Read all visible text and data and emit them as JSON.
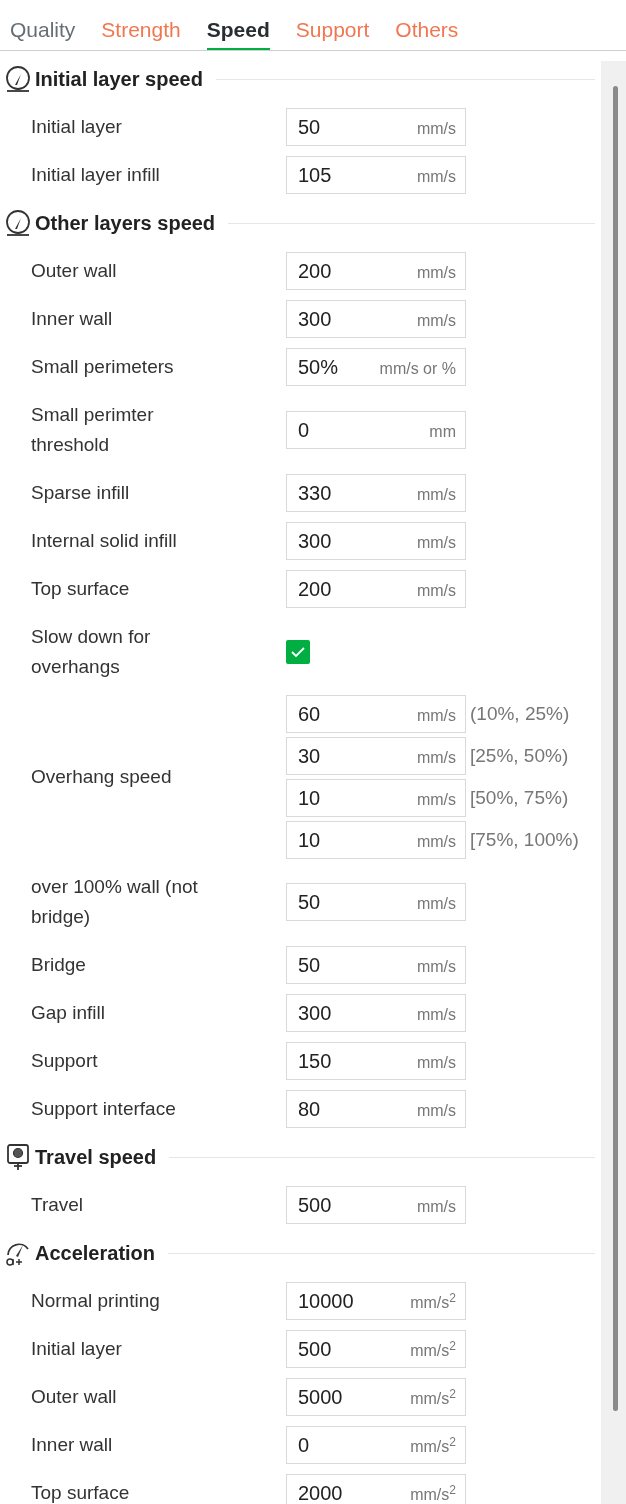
{
  "tabs": [
    {
      "label": "Quality",
      "selected": false,
      "modified": false
    },
    {
      "label": "Strength",
      "selected": false,
      "modified": true
    },
    {
      "label": "Speed",
      "selected": true
    },
    {
      "label": "Support",
      "selected": false,
      "modified": true
    },
    {
      "label": "Others",
      "selected": false,
      "modified": true
    }
  ],
  "sections": [
    {
      "title": "Initial layer speed",
      "kind": "gauge",
      "rows": [
        {
          "kind": "field",
          "label": "Initial layer",
          "value": "50",
          "unit": "mm/s"
        },
        {
          "kind": "field",
          "label": "Initial layer infill",
          "value": "105",
          "unit": "mm/s"
        }
      ]
    },
    {
      "title": "Other layers speed",
      "kind": "gauge",
      "rows": [
        {
          "kind": "field",
          "label": "Outer wall",
          "value": "200",
          "unit": "mm/s"
        },
        {
          "kind": "field",
          "label": "Inner wall",
          "value": "300",
          "unit": "mm/s"
        },
        {
          "kind": "field",
          "label": "Small perimeters",
          "value": "50%",
          "unit": "mm/s or %"
        },
        {
          "kind": "field",
          "label": "Small perimter threshold",
          "value": "0",
          "unit": "mm"
        },
        {
          "kind": "field",
          "label": "Sparse infill",
          "value": "330",
          "unit": "mm/s"
        },
        {
          "kind": "field",
          "label": "Internal solid infill",
          "value": "300",
          "unit": "mm/s"
        },
        {
          "kind": "field",
          "label": "Top surface",
          "value": "200",
          "unit": "mm/s"
        },
        {
          "kind": "checkbox",
          "label": "Slow down for overhangs",
          "checked": true
        },
        {
          "kind": "multi",
          "label": "Overhang speed",
          "fields": [
            {
              "value": "60",
              "unit": "mm/s",
              "range": "(10%, 25%)"
            },
            {
              "value": "30",
              "unit": "mm/s",
              "range": "[25%, 50%)"
            },
            {
              "value": "10",
              "unit": "mm/s",
              "range": "[50%, 75%)"
            },
            {
              "value": "10",
              "unit": "mm/s",
              "range": "[75%, 100%)"
            }
          ]
        },
        {
          "kind": "field",
          "label": "over 100% wall (not bridge)",
          "value": "50",
          "unit": "mm/s"
        },
        {
          "kind": "field",
          "label": "Bridge",
          "value": "50",
          "unit": "mm/s"
        },
        {
          "kind": "field",
          "label": "Gap infill",
          "value": "300",
          "unit": "mm/s"
        },
        {
          "kind": "field",
          "label": "Support",
          "value": "150",
          "unit": "mm/s"
        },
        {
          "kind": "field",
          "label": "Support interface",
          "value": "80",
          "unit": "mm/s"
        }
      ]
    },
    {
      "title": "Travel speed",
      "kind": "travel",
      "rows": [
        {
          "kind": "field",
          "label": "Travel",
          "value": "500",
          "unit": "mm/s"
        }
      ]
    },
    {
      "title": "Acceleration",
      "kind": "accel",
      "rows": [
        {
          "kind": "field",
          "label": "Normal printing",
          "value": "10000",
          "unit": "mm/s$^{2}$"
        },
        {
          "kind": "field",
          "label": "Initial layer",
          "value": "500",
          "unit": "mm/s$^{2}$"
        },
        {
          "kind": "field",
          "label": "Outer wall",
          "value": "5000",
          "unit": "mm/s$^{2}$"
        },
        {
          "kind": "field",
          "label": "Inner wall",
          "value": "0",
          "unit": "mm/s$^{2}$"
        },
        {
          "kind": "field",
          "label": "Top surface",
          "value": "2000",
          "unit": "mm/s$^{2}$"
        }
      ]
    }
  ]
}
